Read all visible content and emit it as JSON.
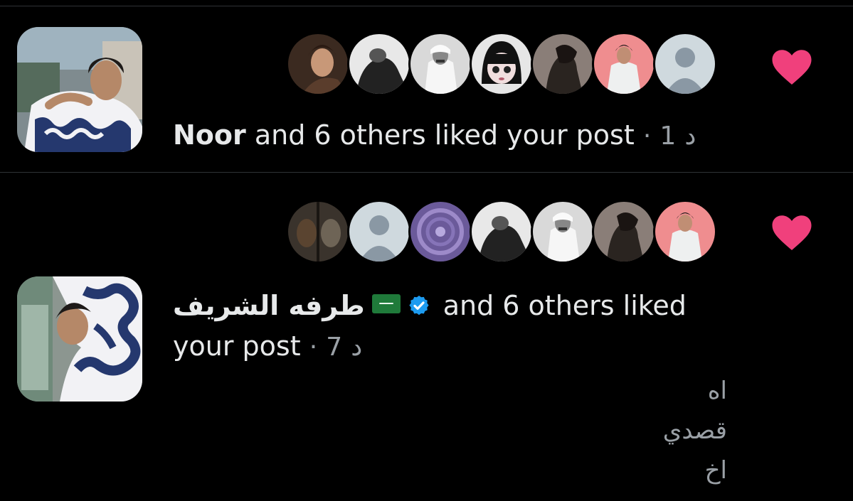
{
  "notifications": [
    {
      "liker_name": "Noor",
      "text": "and 6 others liked your post",
      "separator": "·",
      "time_number": "1",
      "time_unit": "د",
      "avatars": [
        "avatar-woman-portrait",
        "avatar-bw-man-sky",
        "avatar-man-white-thobe",
        "avatar-doll-girl",
        "avatar-dark-profile",
        "avatar-woman-pink",
        "avatar-default-gray"
      ]
    },
    {
      "liker_name": "طرفه الشريف",
      "text_line1": "and 6 others liked",
      "text_line2": "your post",
      "separator": "·",
      "time_number": "7",
      "time_unit": "د",
      "avatars": [
        "avatar-two-faces-dark",
        "avatar-default-gray",
        "avatar-purple-swirl",
        "avatar-bw-man-sky",
        "avatar-man-white-thobe",
        "avatar-dark-profile",
        "avatar-woman-pink"
      ],
      "reply_lines": [
        "اه",
        "قصدي",
        "اخ"
      ]
    }
  ],
  "colors": {
    "heart": "#f0407c",
    "background": "#000000",
    "text": "#e7e9ea",
    "muted": "#9aa0a6",
    "verified": "#1d9bf0"
  }
}
